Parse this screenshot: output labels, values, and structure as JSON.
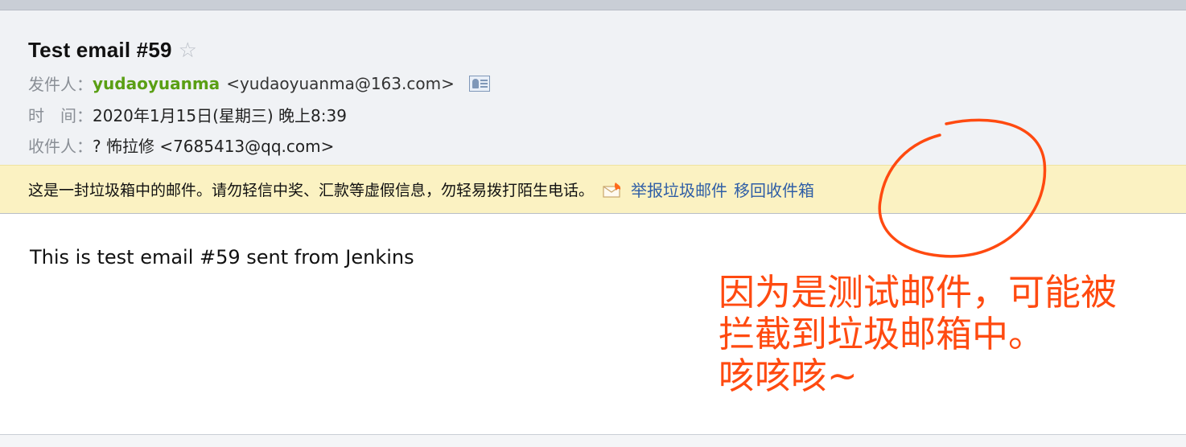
{
  "email": {
    "subject": "Test email #59",
    "star_glyph": "☆",
    "from_label": "发件人：",
    "from_name": "yudaoyuanma",
    "from_email": "<yudaoyuanma@163.com>",
    "time_label": "时　间：",
    "time_value": "2020年1月15日(星期三) 晚上8:39",
    "to_label": "收件人：",
    "to_value": "? 怖拉修 <7685413@qq.com>",
    "body": "This is test email #59 sent from Jenkins"
  },
  "spam_bar": {
    "message": "这是一封垃圾箱中的邮件。请勿轻信中奖、汇款等虚假信息，勿轻易拨打陌生电话。",
    "report_link": "举报垃圾邮件",
    "move_link": "移回收件箱"
  },
  "annotation": {
    "text": "因为是测试邮件，可能被\n拦截到垃圾邮箱中。\n咳咳咳~",
    "color": "#ff4a10"
  },
  "icons": {
    "star": "star-icon",
    "contact_card": "contact-card-icon",
    "report": "report-spam-icon"
  }
}
